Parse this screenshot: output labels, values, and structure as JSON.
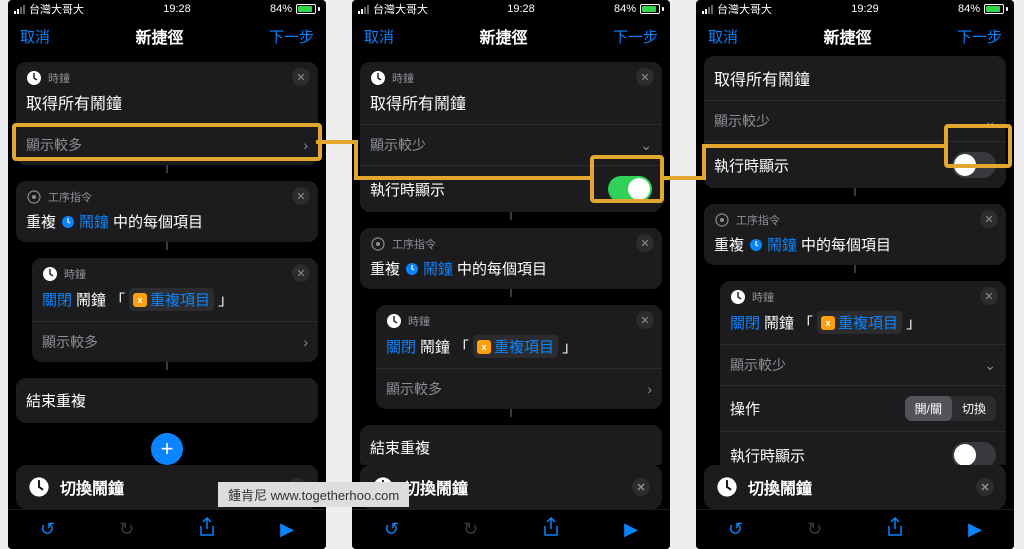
{
  "status": {
    "carrier": "台灣大哥大",
    "time_a": "19:28",
    "time_c": "19:29",
    "battery": "84%"
  },
  "nav": {
    "cancel": "取消",
    "title": "新捷徑",
    "next": "下一步"
  },
  "apps": {
    "clock": "時鐘",
    "script": "工序指令"
  },
  "labels": {
    "get_all_alarms": "取得所有鬧鐘",
    "show_more": "顯示較多",
    "show_less": "顯示較少",
    "run_show": "執行時顯示",
    "repeat_prefix": "重複",
    "alarm_token": "鬧鐘",
    "repeat_suffix": "中的每個項目",
    "close_word": "關閉",
    "alarm_word": "鬧鐘",
    "open_br": "「",
    "close_br": "」",
    "repeat_item": "重複項目",
    "end_repeat": "結束重複",
    "operation": "操作",
    "seg_open_close": "開/關",
    "seg_toggle": "切換",
    "shortcut_name": "切換鬧鐘"
  },
  "watermark": "鍾肯尼   www.togetherhoo.com"
}
